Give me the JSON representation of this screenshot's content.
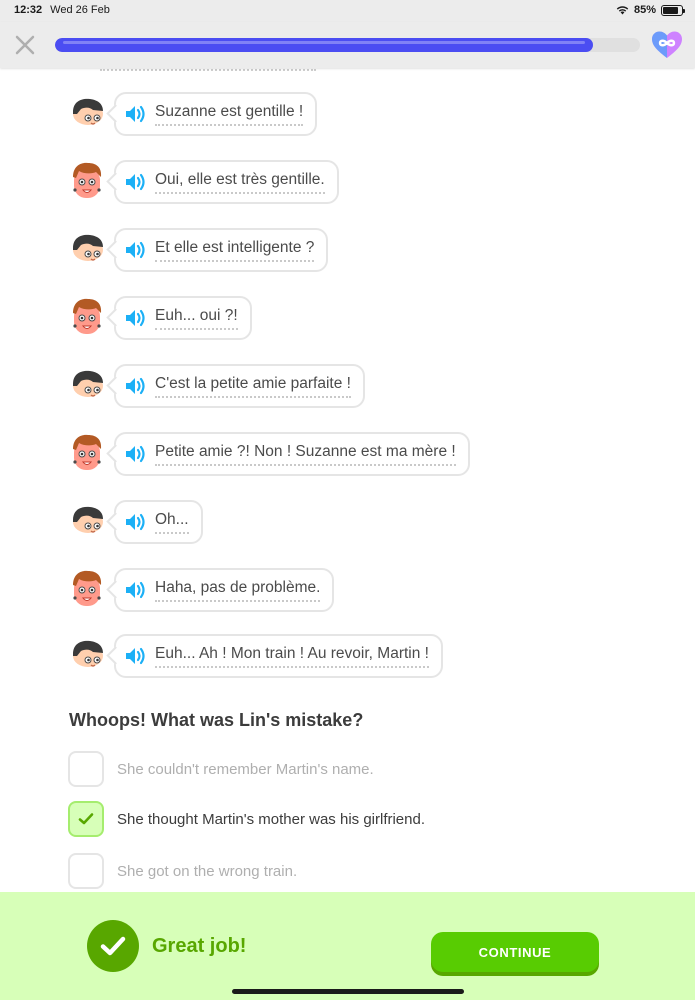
{
  "status_bar": {
    "time": "12:32",
    "date": "Wed 26 Feb",
    "battery_percent": "85%",
    "battery_level": 0.85,
    "wifi_icon": "wifi-icon",
    "battery_icon": "battery-icon"
  },
  "header": {
    "close_icon": "close-icon",
    "progress": 0.92,
    "hearts_icon": "infinite-hearts-icon",
    "progress_color": "#4b4df2",
    "hearts_color": "#ce82ff"
  },
  "dialogue": [
    {
      "speaker": "lin",
      "text": "Suzanne est gentille !"
    },
    {
      "speaker": "martin",
      "text": "Oui, elle est très gentille."
    },
    {
      "speaker": "lin",
      "text": "Et elle est intelligente ?"
    },
    {
      "speaker": "martin",
      "text": "Euh... oui ?!"
    },
    {
      "speaker": "lin",
      "text": "C'est la petite amie parfaite !"
    },
    {
      "speaker": "martin",
      "text": "Petite amie ?! Non ! Suzanne est ma mère !"
    },
    {
      "speaker": "lin",
      "text": "Oh..."
    },
    {
      "speaker": "martin",
      "text": "Haha, pas de problème."
    },
    {
      "speaker": "lin",
      "text": "Euh... Ah ! Mon train ! Au revoir, Martin !"
    }
  ],
  "question": {
    "title": "Whoops! What was Lin's mistake?",
    "options": [
      {
        "text": "She couldn't remember Martin's name.",
        "selected": false
      },
      {
        "text": "She thought Martin's mother was his girlfriend.",
        "selected": true
      },
      {
        "text": "She got on the wrong train.",
        "selected": false
      }
    ]
  },
  "feedback": {
    "message": "Great job!",
    "continue_label": "CONTINUE",
    "background_color": "#d7ffb8",
    "accent_color": "#58cc02"
  }
}
